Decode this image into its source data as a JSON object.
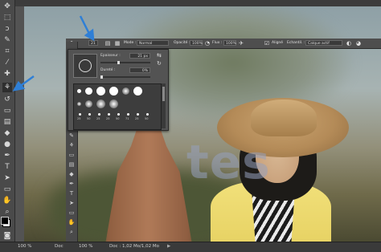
{
  "options_bar": {
    "mode_label": "Mode :",
    "mode_value": "Normal",
    "opacity_label": "Opacité :",
    "opacity_value": "100%",
    "flow_label": "Flux :",
    "flow_value": "100%",
    "aligned_label": "Aligné",
    "sample_label": "Echantil. :",
    "sample_value": "Calque actif",
    "brush_size": "21"
  },
  "brush_popup": {
    "size_label": "Epaisseur :",
    "size_value": "21 px",
    "hardness_label": "Dureté :",
    "hardness_value": "0%",
    "hardness_level": 0,
    "size_level": 0.35,
    "preset_sizes_row3": [
      "25",
      "50",
      "25",
      "25",
      "50",
      "71",
      "25",
      "50"
    ]
  },
  "status_bar": {
    "zoom_left": "100 %",
    "doc_left": "Doc",
    "zoom_right": "100 %",
    "doc_right": "Doc : 1,02 Mo/1,02 Mo"
  },
  "watermark": "tes",
  "colors": {
    "annotation_arrow": "#2f7fd6",
    "panel": "#535353",
    "toolbar": "#4a4a4a"
  }
}
